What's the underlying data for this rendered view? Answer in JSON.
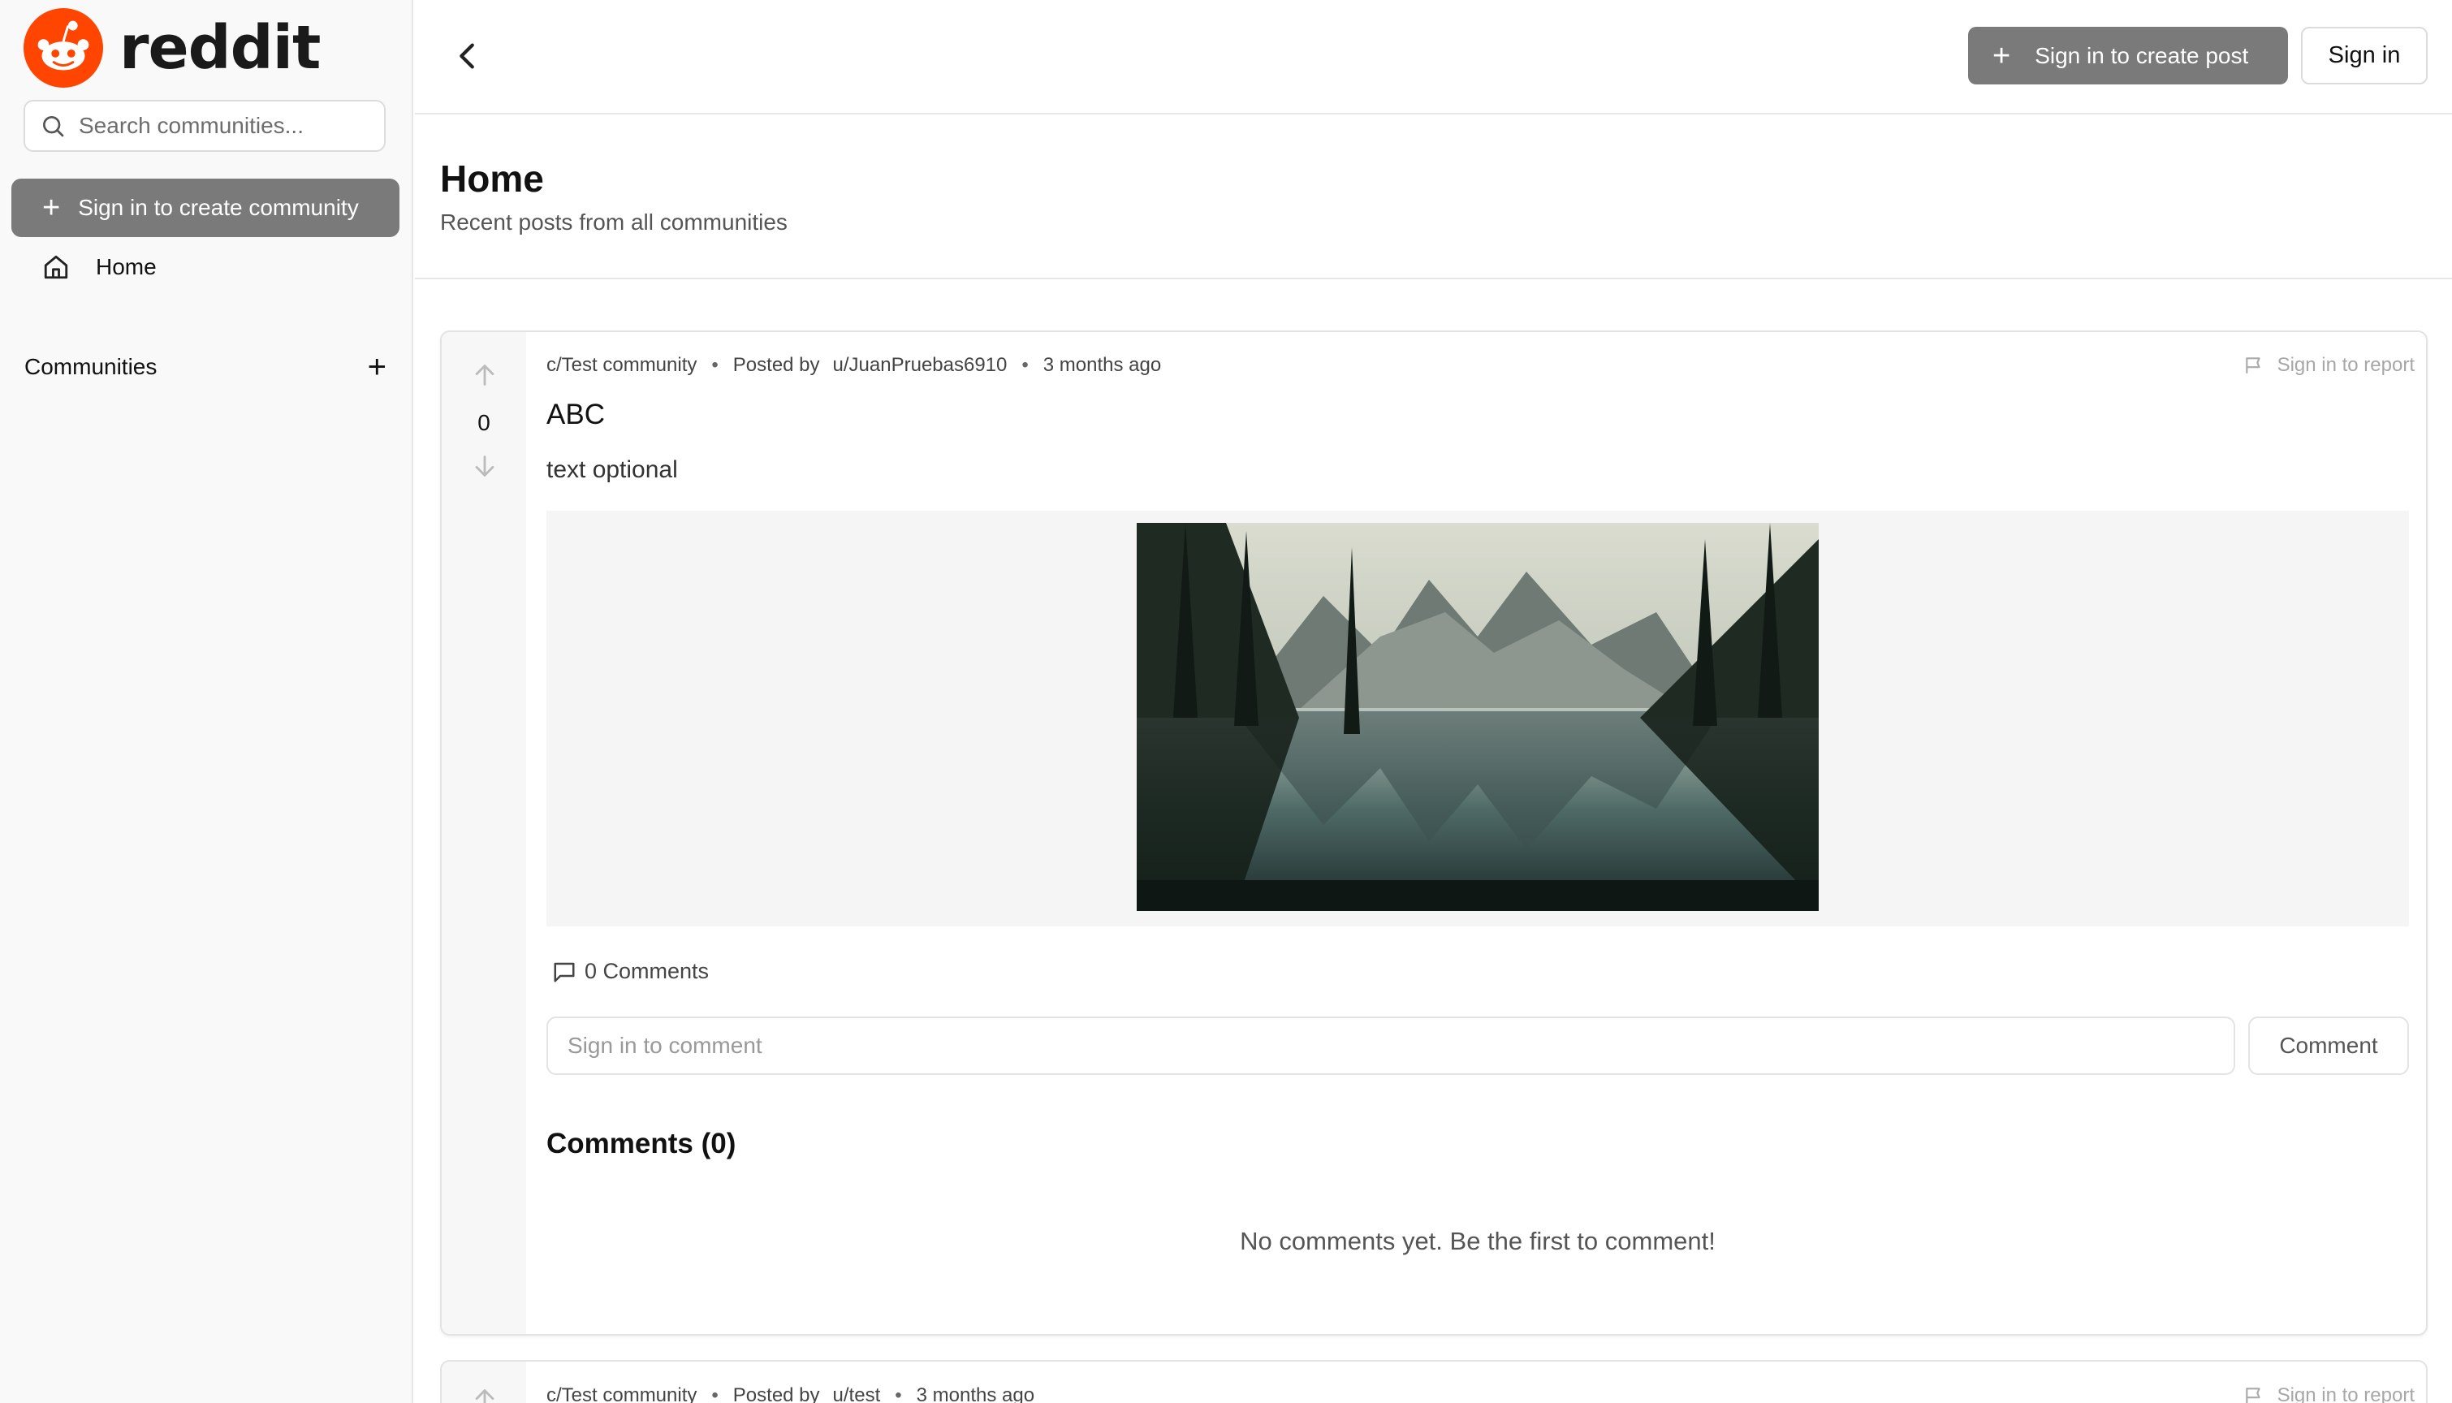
{
  "sidebar": {
    "logo_text": "reddit",
    "search_placeholder": "Search communities...",
    "create_community_label": "Sign in to create community",
    "nav": [
      {
        "label": "Home",
        "icon": "home-icon"
      }
    ],
    "communities_label": "Communities"
  },
  "header": {
    "create_post_label": "Sign in to create post",
    "sign_in_label": "Sign in"
  },
  "page": {
    "title": "Home",
    "subtitle": "Recent posts from all communities"
  },
  "posts": [
    {
      "community": "c/Test community",
      "posted_by_label": "Posted by",
      "author": "u/JuanPruebas6910",
      "time": "3 months ago",
      "report_label": "Sign in to report",
      "votes": "0",
      "title": "ABC",
      "body": "text optional",
      "image": "mountain-lake-landscape",
      "comments_count_label": "0 Comments",
      "comment_placeholder": "Sign in to comment",
      "comment_button_label": "Comment",
      "comments_heading": "Comments (0)",
      "empty_comments_text": "No comments yet. Be the first to comment!"
    },
    {
      "community": "c/Test community",
      "posted_by_label": "Posted by",
      "author": "u/test",
      "time": "3 months ago",
      "report_label": "Sign in to report"
    }
  ],
  "colors": {
    "brand": "#ff4500",
    "disabled_button": "#7a7a7a",
    "border": "#e3e3e3",
    "sidebar_bg": "#f9f9f9"
  }
}
